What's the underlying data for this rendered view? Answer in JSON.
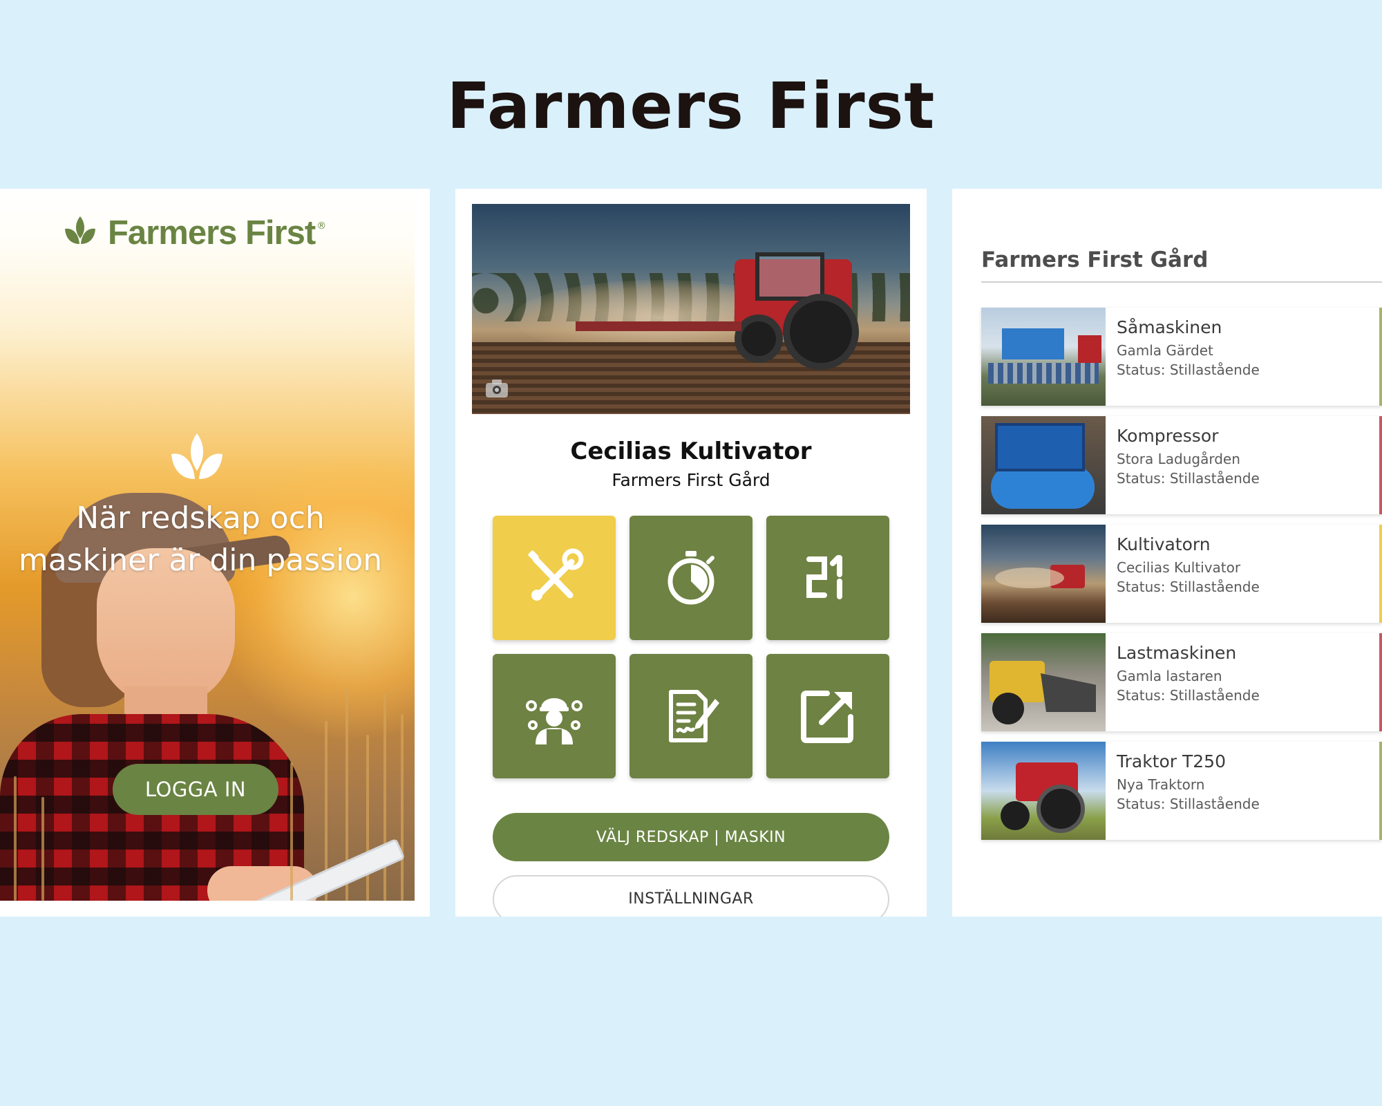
{
  "page": {
    "title": "Farmers First",
    "background": "#daf1fc"
  },
  "login": {
    "logo_text": "Farmers First",
    "logo_trademark": "®",
    "tagline_line1": "När redskap och",
    "tagline_line2": "maskiner är din passion",
    "login_button": "LOGGA IN",
    "brand_color": "#6a8443"
  },
  "detail": {
    "photo_icon": "camera-icon",
    "machine_name": "Cecilias Kultivator",
    "farm_name": "Farmers First Gård",
    "tiles": [
      {
        "icon": "wrench-screwdriver-icon",
        "color": "#f0cd4a"
      },
      {
        "icon": "stopwatch-icon",
        "color": "#6e8243"
      },
      {
        "icon": "digital-21-icon",
        "color": "#6e8243"
      },
      {
        "icon": "mechanic-icon",
        "color": "#6e8243"
      },
      {
        "icon": "document-edit-icon",
        "color": "#6e8243"
      },
      {
        "icon": "external-link-icon",
        "color": "#6e8243"
      }
    ],
    "select_button": "VÄLJ REDSKAP | MASKIN",
    "settings_button": "INSTÄLLNINGAR"
  },
  "machines": {
    "farm_title": "Farmers First Gård",
    "items": [
      {
        "name": "Såmaskinen",
        "location": "Gamla Gärdet",
        "status": "Status: Stillastående",
        "stripe": "#a9b26b"
      },
      {
        "name": "Kompressor",
        "location": "Stora Ladugården",
        "status": "Status: Stillastående",
        "stripe": "#c9575c"
      },
      {
        "name": "Kultivatorn",
        "location": "Cecilias Kultivator",
        "status": "Status: Stillastående",
        "stripe": "#f0cd4a"
      },
      {
        "name": "Lastmaskinen",
        "location": "Gamla lastaren",
        "status": "Status: Stillastående",
        "stripe": "#c9575c"
      },
      {
        "name": "Traktor T250",
        "location": "Nya Traktorn",
        "status": "Status: Stillastående",
        "stripe": "#a9b26b"
      }
    ]
  }
}
